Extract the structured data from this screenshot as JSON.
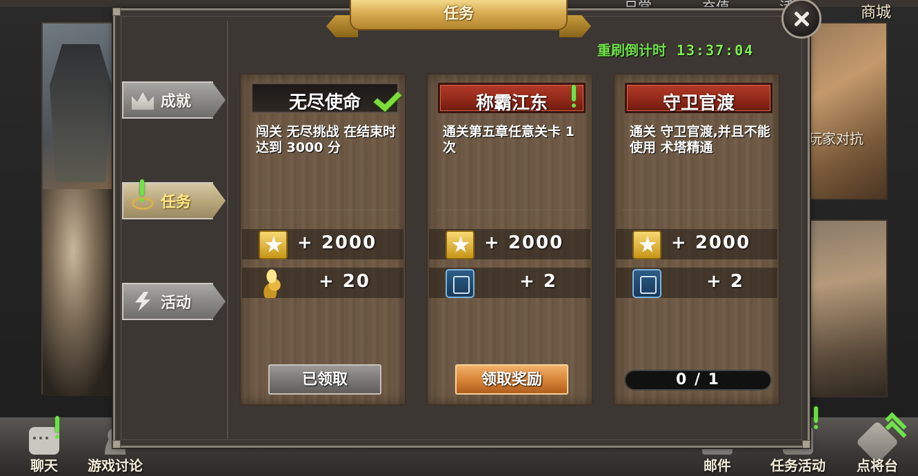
{
  "background": {
    "top_items": [
      "日常",
      "充值",
      "活"
    ],
    "shop_label": "商城",
    "right_label": "玩家对抗",
    "bottom_nav": [
      {
        "label": "聊天",
        "icon": "chat-icon",
        "badge": true
      },
      {
        "label": "游戏讨论",
        "icon": "person-icon",
        "badge": false
      },
      {
        "label": "邮件",
        "icon": "mail-icon",
        "badge": false
      },
      {
        "label": "任务活动",
        "icon": "task-icon",
        "badge": true
      },
      {
        "label": "点将台",
        "icon": "general-icon",
        "badge": false
      }
    ]
  },
  "dialog": {
    "title": "任务",
    "close_icon": "close-icon",
    "countdown": {
      "label": "重刷倒计时",
      "time": "13:37:04",
      "color": "#6fe24a"
    }
  },
  "tabs": [
    {
      "label": "成就",
      "icon": "crown-icon",
      "active": false
    },
    {
      "label": "任务",
      "icon": "quest-icon",
      "active": true,
      "badge": true
    },
    {
      "label": "活动",
      "icon": "lightning-icon",
      "active": false
    }
  ],
  "cards": [
    {
      "title": "无尽使命",
      "title_style": "dark",
      "status_icon": "checkmark-icon",
      "description": "闯关 无尽挑战 在结束时达到 3000 分",
      "rewards": [
        {
          "icon": "star-icon",
          "value": "+ 2000"
        },
        {
          "icon": "coin-icon",
          "value": "+ 20"
        }
      ],
      "action": {
        "type": "button",
        "label": "已领取",
        "state": "claimed"
      }
    },
    {
      "title": "称霸江东",
      "title_style": "red",
      "status_icon": "exclamation-icon",
      "description": "通关第五章任意关卡 1 次",
      "rewards": [
        {
          "icon": "star-icon",
          "value": "+ 2000"
        },
        {
          "icon": "card-pack-icon",
          "value": "+ 2"
        }
      ],
      "action": {
        "type": "button",
        "label": "领取奖励",
        "state": "claimable"
      }
    },
    {
      "title": "守卫官渡",
      "title_style": "red",
      "status_icon": "",
      "description": "通关 守卫官渡,并且不能使用 术塔精通",
      "rewards": [
        {
          "icon": "star-icon",
          "value": "+ 2000"
        },
        {
          "icon": "card-pack-icon",
          "value": "+ 2"
        }
      ],
      "action": {
        "type": "progress",
        "label": "0 / 1",
        "progress": 0
      }
    }
  ],
  "colors": {
    "accent_green": "#6fe24a",
    "claim_orange": "#d9863a",
    "title_red": "#8e2718",
    "banner_gold": "#d8ac52"
  }
}
